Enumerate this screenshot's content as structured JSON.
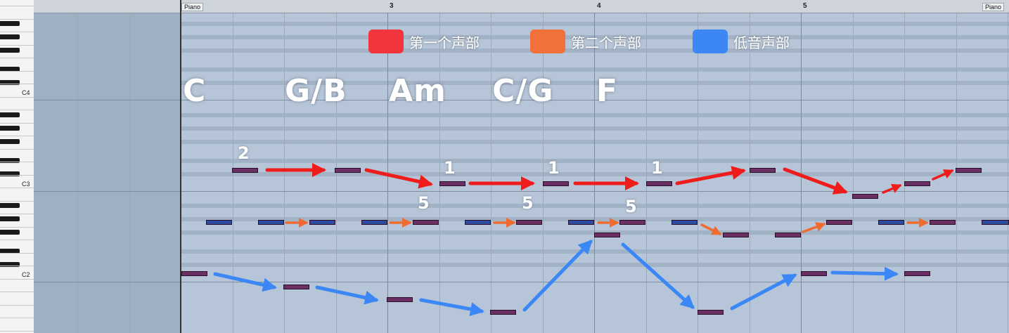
{
  "ruler": {
    "track_start_label": "Piano",
    "track_end_label": "Piano",
    "bars": [
      "3",
      "4",
      "5"
    ]
  },
  "keyboard": {
    "octaves": [
      "C4",
      "C3",
      "C2"
    ]
  },
  "legend": [
    {
      "label": "第一个声部",
      "color": "#f0363c"
    },
    {
      "label": "第二个声部",
      "color": "#f2703a"
    },
    {
      "label": "低音声部",
      "color": "#3c86f6"
    }
  ],
  "chords": [
    "C",
    "G/B",
    "Am",
    "C/G",
    "F"
  ],
  "degrees": {
    "upper": [
      "2",
      "1",
      "1",
      "1"
    ],
    "middle": [
      "5",
      "5",
      "5"
    ]
  },
  "colors": {
    "note_fill": "#6a2f63",
    "note_blue": "#2c4aa0",
    "arrow_red": "#ef1c1c",
    "arrow_orange": "#f06b30",
    "arrow_blue": "#3a87f5"
  }
}
